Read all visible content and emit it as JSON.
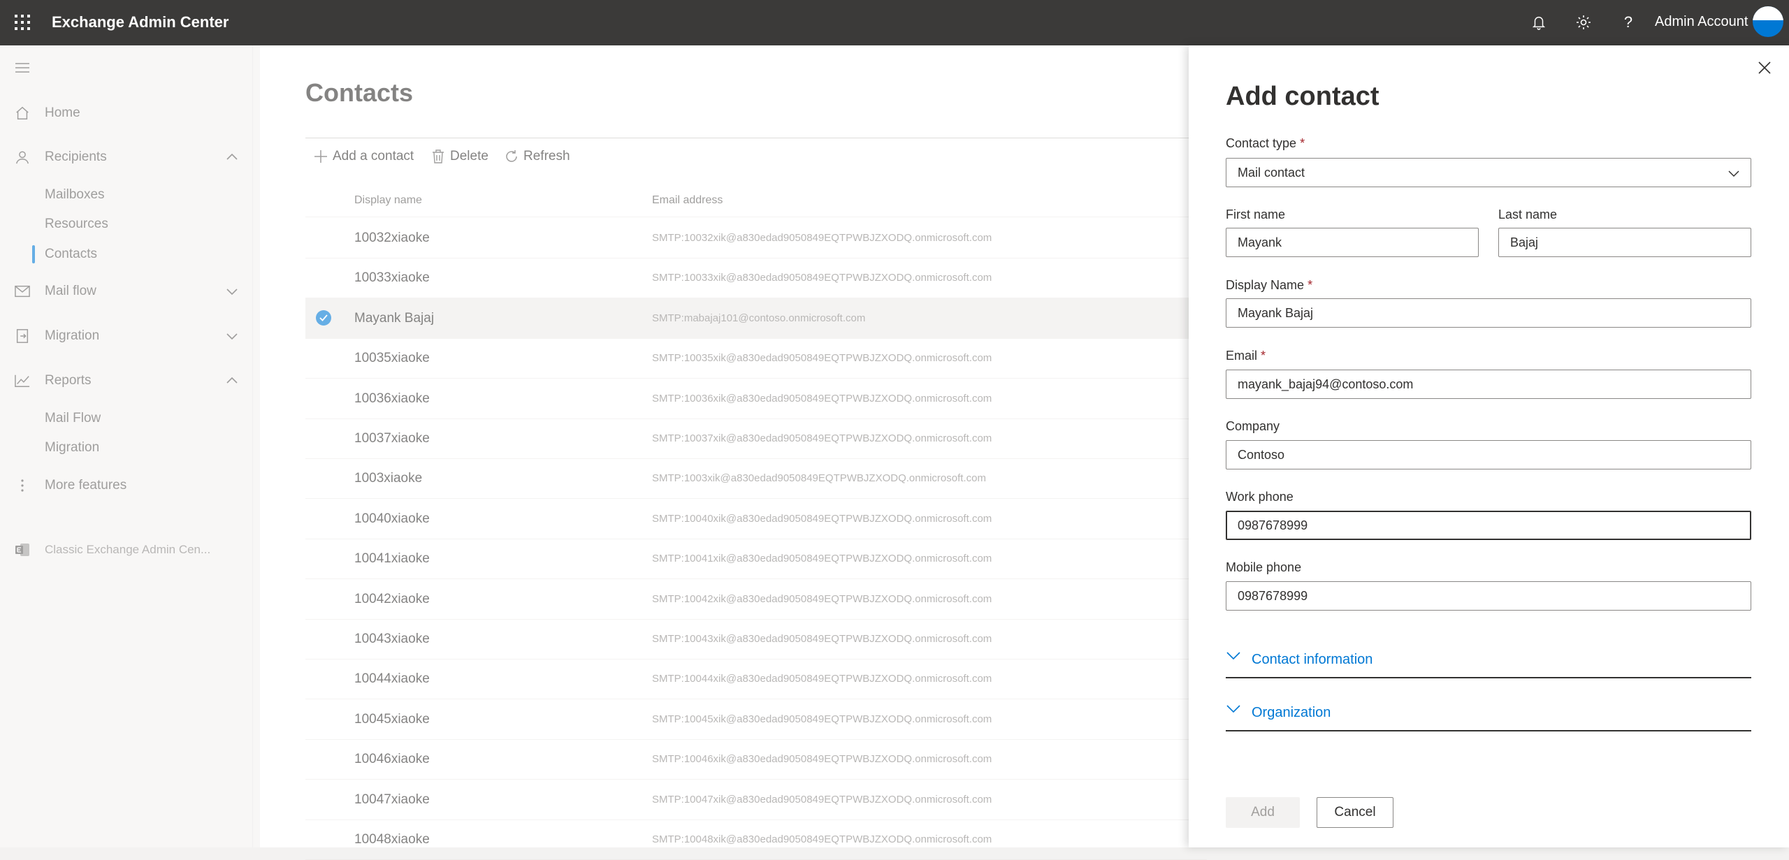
{
  "topbar": {
    "app_title": "Exchange Admin Center",
    "account_name": "Admin Account"
  },
  "leftnav": {
    "home": "Home",
    "recipients": "Recipients",
    "mailboxes": "Mailboxes",
    "resources": "Resources",
    "contacts": "Contacts",
    "mail_flow": "Mail flow",
    "migration": "Migration",
    "reports": "Reports",
    "reports_mail_flow": "Mail Flow",
    "reports_migration": "Migration",
    "more_features": "More features",
    "classic_eac": "Classic Exchange Admin Cen..."
  },
  "main": {
    "title": "Contacts",
    "commands": {
      "add": "Add a contact",
      "delete": "Delete",
      "refresh": "Refresh"
    },
    "columns": {
      "display_name": "Display name",
      "email": "Email address"
    },
    "rows": [
      {
        "name": "10032xiaoke",
        "email": "SMTP:10032xik@a830edad9050849EQTPWBJZXODQ.onmicrosoft.com"
      },
      {
        "name": "10033xiaoke",
        "email": "SMTP:10033xik@a830edad9050849EQTPWBJZXODQ.onmicrosoft.com"
      },
      {
        "name": "Mayank Bajaj",
        "email": "SMTP:mabajaj101@contoso.onmicrosoft.com"
      },
      {
        "name": "10035xiaoke",
        "email": "SMTP:10035xik@a830edad9050849EQTPWBJZXODQ.onmicrosoft.com"
      },
      {
        "name": "10036xiaoke",
        "email": "SMTP:10036xik@a830edad9050849EQTPWBJZXODQ.onmicrosoft.com"
      },
      {
        "name": "10037xiaoke",
        "email": "SMTP:10037xik@a830edad9050849EQTPWBJZXODQ.onmicrosoft.com"
      },
      {
        "name": "1003xiaoke",
        "email": "SMTP:1003xik@a830edad9050849EQTPWBJZXODQ.onmicrosoft.com"
      },
      {
        "name": "10040xiaoke",
        "email": "SMTP:10040xik@a830edad9050849EQTPWBJZXODQ.onmicrosoft.com"
      },
      {
        "name": "10041xiaoke",
        "email": "SMTP:10041xik@a830edad9050849EQTPWBJZXODQ.onmicrosoft.com"
      },
      {
        "name": "10042xiaoke",
        "email": "SMTP:10042xik@a830edad9050849EQTPWBJZXODQ.onmicrosoft.com"
      },
      {
        "name": "10043xiaoke",
        "email": "SMTP:10043xik@a830edad9050849EQTPWBJZXODQ.onmicrosoft.com"
      },
      {
        "name": "10044xiaoke",
        "email": "SMTP:10044xik@a830edad9050849EQTPWBJZXODQ.onmicrosoft.com"
      },
      {
        "name": "10045xiaoke",
        "email": "SMTP:10045xik@a830edad9050849EQTPWBJZXODQ.onmicrosoft.com"
      },
      {
        "name": "10046xiaoke",
        "email": "SMTP:10046xik@a830edad9050849EQTPWBJZXODQ.onmicrosoft.com"
      },
      {
        "name": "10047xiaoke",
        "email": "SMTP:10047xik@a830edad9050849EQTPWBJZXODQ.onmicrosoft.com"
      },
      {
        "name": "10048xiaoke",
        "email": "SMTP:10048xik@a830edad9050849EQTPWBJZXODQ.onmicrosoft.com"
      }
    ]
  },
  "panel": {
    "title": "Add contact",
    "contact_type_label": "Contact type",
    "contact_type_value": "Mail contact",
    "first_name_label": "First name",
    "first_name_value": "Mayank",
    "last_name_label": "Last name",
    "last_name_value": "Bajaj",
    "display_name_label": "Display Name",
    "display_name_value": "Mayank Bajaj",
    "email_label": "Email",
    "email_value": "mayank_bajaj94@contoso.com",
    "company_label": "Company",
    "company_value": "Contoso",
    "work_phone_label": "Work phone",
    "work_phone_value": "0987678999",
    "mobile_phone_label": "Mobile phone",
    "mobile_phone_value": "0987678999",
    "required_mark": "*",
    "section_contact_info": "Contact information",
    "section_organization": "Organization",
    "add_button": "Add",
    "cancel_button": "Cancel"
  },
  "colors": {
    "accent": "#0078d4",
    "topbar": "#3b3a39",
    "required": "#a4262c"
  }
}
